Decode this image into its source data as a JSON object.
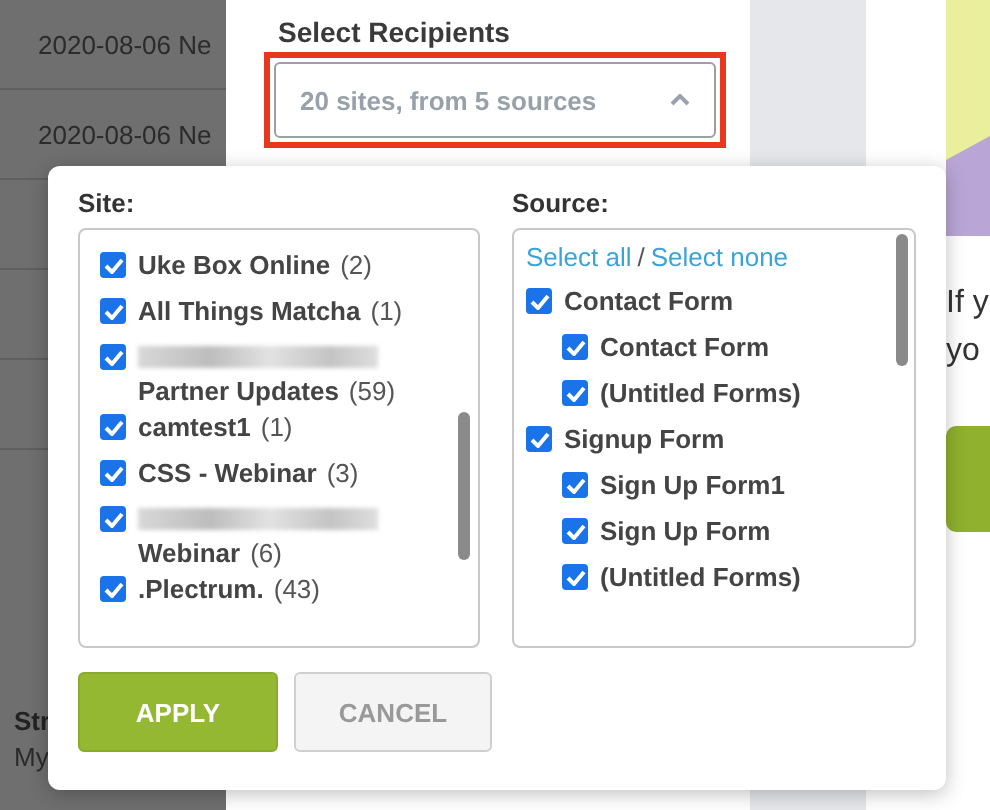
{
  "background": {
    "rows": [
      "2020-08-06 Ne",
      "2020-08-06 Ne"
    ],
    "footer": {
      "heading": "Str",
      "link": "My"
    },
    "panel": {
      "title": "Select Recipients",
      "dropdown": {
        "value": "20 sites, from 5 sources",
        "expanded": true,
        "highlighted": true
      }
    },
    "side": {
      "lines": [
        "If y",
        "yo"
      ]
    }
  },
  "popup": {
    "site": {
      "label": "Site:",
      "items": [
        {
          "name": "Uke Box Online",
          "count": "(2)",
          "checked": true,
          "blurred_line": false
        },
        {
          "name": "All Things Matcha",
          "count": "(1)",
          "checked": true,
          "blurred_line": false
        },
        {
          "name": "Partner Updates",
          "count": "(59)",
          "checked": true,
          "blurred_line": true
        },
        {
          "name": "camtest1",
          "count": "(1)",
          "checked": true,
          "blurred_line": false
        },
        {
          "name": "CSS - Webinar",
          "count": "(3)",
          "checked": true,
          "blurred_line": false
        },
        {
          "name": "Webinar",
          "count": "(6)",
          "checked": true,
          "blurred_line": true
        },
        {
          "name": ".Plectrum.",
          "count": "(43)",
          "checked": true,
          "blurred_line": false
        }
      ]
    },
    "source": {
      "label": "Source:",
      "select_all": "Select all",
      "separator": "/",
      "select_none": "Select none",
      "items": [
        {
          "name": "Contact Form",
          "checked": true,
          "children": [
            {
              "name": "Contact Form",
              "checked": true
            },
            {
              "name": "(Untitled Forms)",
              "checked": true
            }
          ]
        },
        {
          "name": "Signup Form",
          "checked": true,
          "children": [
            {
              "name": "Sign Up Form1",
              "checked": true
            },
            {
              "name": "Sign Up Form",
              "checked": true
            },
            {
              "name": "(Untitled Forms)",
              "checked": true
            }
          ]
        }
      ]
    },
    "buttons": {
      "apply": "APPLY",
      "cancel": "CANCEL"
    }
  }
}
